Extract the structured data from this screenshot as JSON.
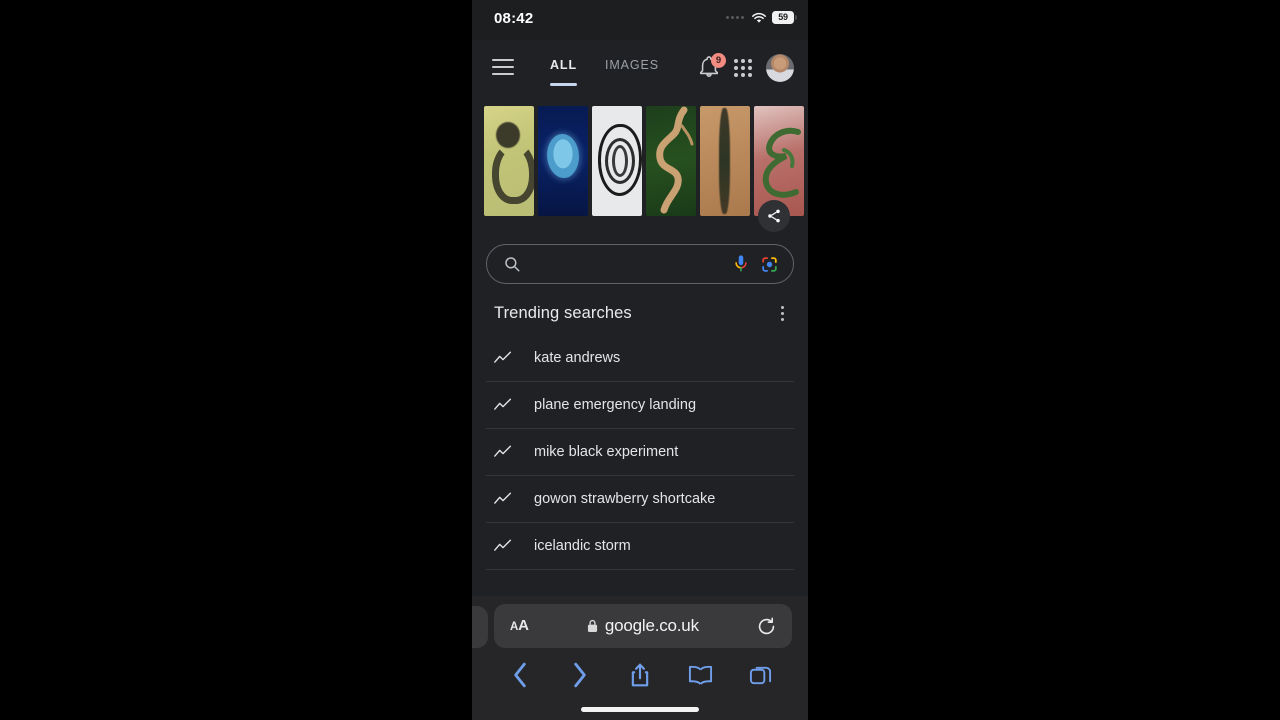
{
  "status_bar": {
    "time": "08:42",
    "wifi_icon": "wifi-icon",
    "battery_level": "59",
    "signal_dots_icon": "cellular-dots-icon"
  },
  "google_header": {
    "menu_icon": "hamburger-menu-icon",
    "tabs": [
      {
        "label": "ALL",
        "active": true
      },
      {
        "label": "IMAGES",
        "active": false
      }
    ],
    "notifications": {
      "icon": "bell-icon",
      "badge_count": "9",
      "badge_color": "#f28b82"
    },
    "apps_grid_icon": "apps-grid-icon",
    "account_avatar_icon": "profile-avatar-icon"
  },
  "doodle": {
    "name": "google-doodle",
    "share_icon": "share-icon",
    "panels": [
      {
        "letter": "G",
        "description": "olive terrain aerial view"
      },
      {
        "letter": "O",
        "description": "blue atoll satellite view"
      },
      {
        "letter": "O",
        "description": "grey concentric rings aerial view"
      },
      {
        "letter": "G",
        "description": "meandering river in green forest"
      },
      {
        "letter": "L",
        "description": "dark ridge across tan desert"
      },
      {
        "letter": "E",
        "description": "green river delta on red terrain"
      }
    ]
  },
  "search": {
    "placeholder": "",
    "value": "",
    "search_icon": "search-icon",
    "mic_icon": "microphone-icon",
    "lens_icon": "google-lens-icon"
  },
  "trending": {
    "title": "Trending searches",
    "overflow_icon": "more-options-icon",
    "trend_icon": "trending-up-icon",
    "items": [
      {
        "label": "kate andrews"
      },
      {
        "label": "plane emergency landing"
      },
      {
        "label": "mike black experiment"
      },
      {
        "label": "gowon strawberry shortcake"
      },
      {
        "label": "icelandic storm"
      }
    ]
  },
  "browser": {
    "text_size_label_small": "A",
    "text_size_label_big": "A",
    "lock_icon": "lock-icon",
    "url": "google.co.uk",
    "reload_icon": "reload-icon",
    "toolbar": {
      "back_icon": "back-chevron-icon",
      "forward_icon": "forward-chevron-icon",
      "share_icon": "share-upload-icon",
      "bookmarks_icon": "bookmarks-book-icon",
      "tabs_icon": "tabs-overview-icon",
      "accent_color": "#6f9eeb"
    }
  }
}
